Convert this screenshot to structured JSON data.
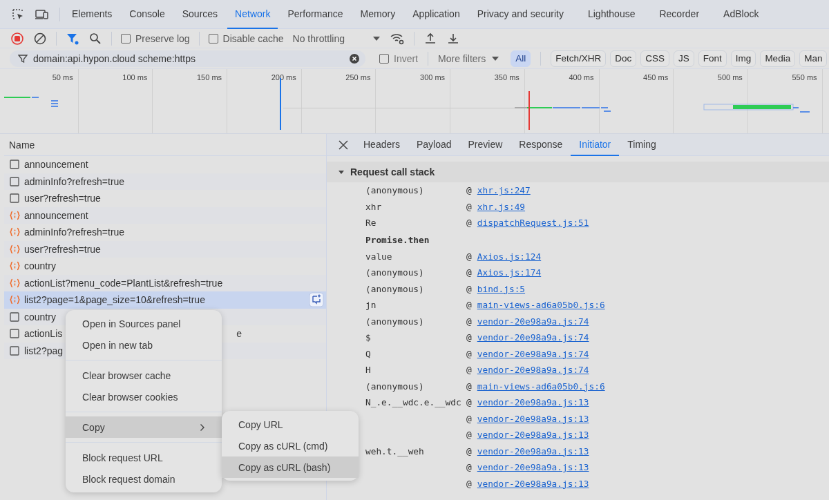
{
  "main_tabs": [
    {
      "label": "Elements",
      "selected": false
    },
    {
      "label": "Console",
      "selected": false
    },
    {
      "label": "Sources",
      "selected": false
    },
    {
      "label": "Network",
      "selected": true
    },
    {
      "label": "Performance",
      "selected": false
    },
    {
      "label": "Memory",
      "selected": false
    },
    {
      "label": "Application",
      "selected": false
    },
    {
      "label": "Privacy and security",
      "selected": false
    },
    {
      "label": "Lighthouse",
      "selected": false
    },
    {
      "label": "Recorder",
      "selected": false
    },
    {
      "label": "AdBlock",
      "selected": false
    }
  ],
  "toolbar": {
    "recording": true,
    "filter_active": true,
    "preserve_log": {
      "label": "Preserve log",
      "checked": false
    },
    "disable_cache": {
      "label": "Disable cache",
      "checked": false
    },
    "throttling": "No throttling"
  },
  "filter": {
    "value": "domain:api.hypon.cloud scheme:https",
    "invert": {
      "label": "Invert",
      "checked": false
    },
    "more_filters": "More filters",
    "types": [
      {
        "label": "All",
        "selected": true
      },
      {
        "label": "Fetch/XHR",
        "selected": false
      },
      {
        "label": "Doc",
        "selected": false
      },
      {
        "label": "CSS",
        "selected": false
      },
      {
        "label": "JS",
        "selected": false
      },
      {
        "label": "Font",
        "selected": false
      },
      {
        "label": "Img",
        "selected": false
      },
      {
        "label": "Media",
        "selected": false
      },
      {
        "label": "Man",
        "selected": false
      }
    ]
  },
  "overview": {
    "ticks": [
      "50 ms",
      "100 ms",
      "150 ms",
      "200 ms",
      "250 ms",
      "300 ms",
      "350 ms",
      "400 ms",
      "450 ms",
      "500 ms",
      "550 ms"
    ]
  },
  "requests": {
    "column": "Name",
    "rows": [
      {
        "kind": "document",
        "name": "announcement",
        "selected": false
      },
      {
        "kind": "document",
        "name": "adminInfo?refresh=true",
        "selected": false
      },
      {
        "kind": "document",
        "name": "user?refresh=true",
        "selected": false
      },
      {
        "kind": "fetch",
        "name": "announcement",
        "selected": false
      },
      {
        "kind": "fetch",
        "name": "adminInfo?refresh=true",
        "selected": false
      },
      {
        "kind": "fetch",
        "name": "user?refresh=true",
        "selected": false
      },
      {
        "kind": "fetch",
        "name": "country",
        "selected": false
      },
      {
        "kind": "fetch",
        "name": "actionList?menu_code=PlantList&refresh=true",
        "selected": false
      },
      {
        "kind": "fetch",
        "name": "list2?page=1&page_size=10&refresh=true",
        "selected": true
      },
      {
        "kind": "document",
        "name": "country",
        "selected": false
      },
      {
        "kind": "document",
        "name": "actionLis",
        "tail": "e",
        "selected": false
      },
      {
        "kind": "document",
        "name": "list2?pag",
        "selected": false
      }
    ]
  },
  "details": {
    "tabs": [
      {
        "label": "Headers",
        "selected": false
      },
      {
        "label": "Payload",
        "selected": false
      },
      {
        "label": "Preview",
        "selected": false
      },
      {
        "label": "Response",
        "selected": false
      },
      {
        "label": "Initiator",
        "selected": true
      },
      {
        "label": "Timing",
        "selected": false
      }
    ],
    "section": {
      "title": "Request call stack",
      "expanded": true,
      "separator": "@",
      "frames": [
        {
          "kind": "frame",
          "function": "(anonymous)",
          "location": "xhr.js:247"
        },
        {
          "kind": "frame",
          "function": "xhr",
          "location": "xhr.js:49"
        },
        {
          "kind": "frame",
          "function": "Re",
          "location": "dispatchRequest.js:51"
        },
        {
          "kind": "async",
          "function": "Promise.then"
        },
        {
          "kind": "frame",
          "function": "value",
          "location": "Axios.js:124"
        },
        {
          "kind": "frame",
          "function": "(anonymous)",
          "location": "Axios.js:174"
        },
        {
          "kind": "frame",
          "function": "(anonymous)",
          "location": "bind.js:5"
        },
        {
          "kind": "frame",
          "function": "jn",
          "location": "main-views-ad6a05b0.js:6"
        },
        {
          "kind": "frame",
          "function": "(anonymous)",
          "location": "vendor-20e98a9a.js:74"
        },
        {
          "kind": "frame",
          "function": "$",
          "location": "vendor-20e98a9a.js:74"
        },
        {
          "kind": "frame",
          "function": "Q",
          "location": "vendor-20e98a9a.js:74"
        },
        {
          "kind": "frame",
          "function": "H",
          "location": "vendor-20e98a9a.js:74"
        },
        {
          "kind": "frame",
          "function": "(anonymous)",
          "location": "main-views-ad6a05b0.js:6"
        },
        {
          "kind": "frame",
          "function": "N_.e.__wdc.e.__wdc",
          "location": "vendor-20e98a9a.js:13"
        },
        {
          "kind": "frame",
          "location": "vendor-20e98a9a.js:13"
        },
        {
          "kind": "frame",
          "location": "vendor-20e98a9a.js:13"
        },
        {
          "kind": "frame",
          "function": "weh.t.__weh",
          "location": "vendor-20e98a9a.js:13"
        },
        {
          "kind": "frame",
          "location": "vendor-20e98a9a.js:13"
        },
        {
          "kind": "frame",
          "location": "vendor-20e98a9a.js:13"
        }
      ]
    }
  },
  "context_menu": {
    "groups": [
      {
        "items": [
          {
            "label": "Open in Sources panel",
            "highlighted": false
          },
          {
            "label": "Open in new tab",
            "highlighted": false
          }
        ]
      },
      {
        "items": [
          {
            "label": "Clear browser cache",
            "highlighted": false
          },
          {
            "label": "Clear browser cookies",
            "highlighted": false
          }
        ]
      },
      {
        "items": [
          {
            "label": "Copy",
            "highlighted": true,
            "submenu": {
              "items": [
                {
                  "label": "Copy URL",
                  "highlighted": false
                },
                {
                  "label": "Copy as cURL (cmd)",
                  "highlighted": false
                },
                {
                  "label": "Copy as cURL (bash)",
                  "highlighted": true
                }
              ]
            }
          }
        ]
      },
      {
        "items": [
          {
            "label": "Block request URL",
            "highlighted": false
          },
          {
            "label": "Block request domain",
            "highlighted": false
          }
        ]
      }
    ]
  }
}
